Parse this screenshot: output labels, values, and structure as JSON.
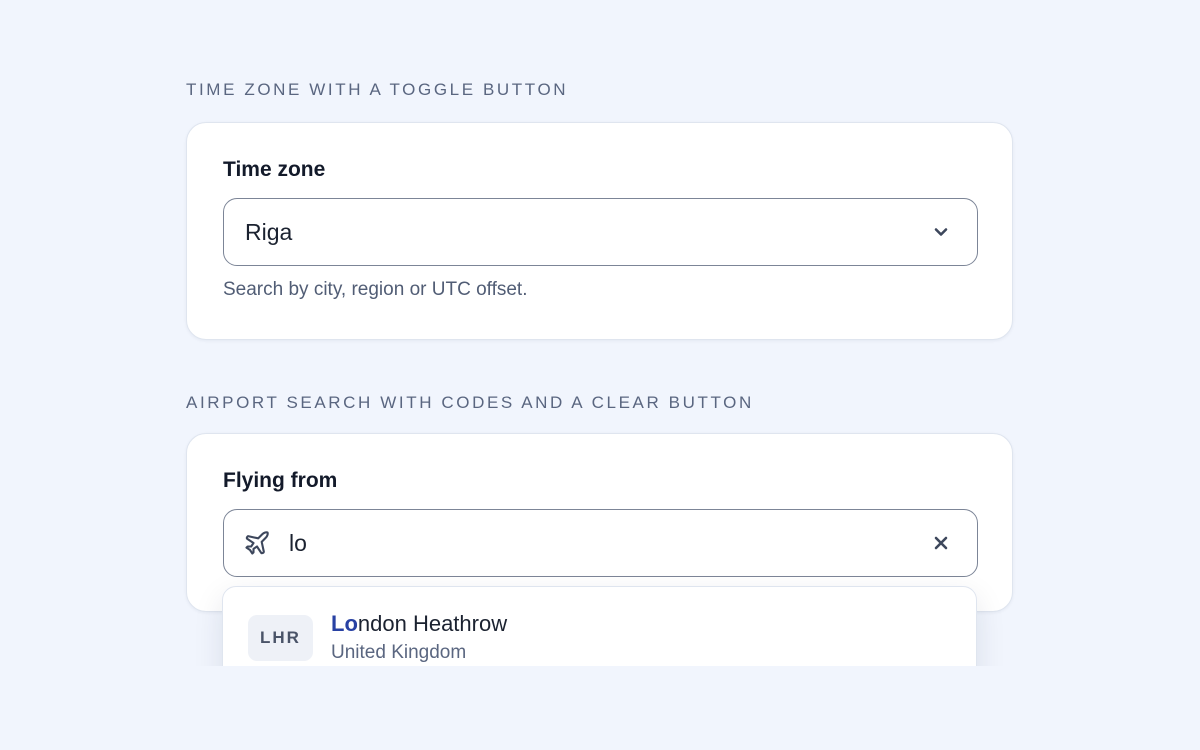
{
  "sections": {
    "timezone": {
      "heading": "TIME ZONE WITH A TOGGLE BUTTON",
      "label": "Time zone",
      "value": "Riga",
      "helper": "Search by city, region or UTC offset.",
      "toggle_icon": "chevron-down-icon"
    },
    "airport": {
      "heading": "AIRPORT SEARCH WITH CODES AND A CLEAR BUTTON",
      "label": "Flying from",
      "value": "lo",
      "leading_icon": "plane-icon",
      "clear_icon": "close-icon",
      "options": [
        {
          "code": "LHR",
          "name_match": "Lo",
          "name_rest": "ndon Heathrow",
          "country": "United Kingdom"
        }
      ]
    }
  },
  "colors": {
    "background": "#f1f5fd",
    "highlight": "#2841a3",
    "border": "#7c8597"
  }
}
